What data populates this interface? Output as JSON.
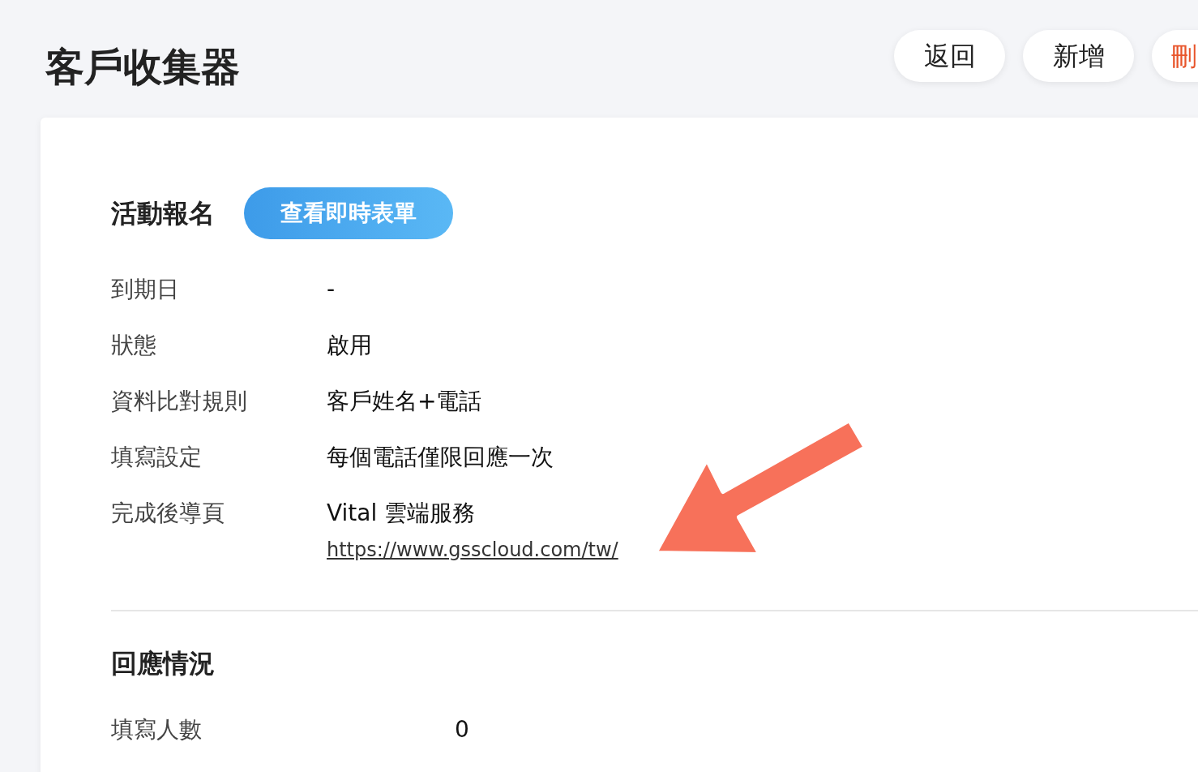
{
  "page": {
    "title": "客戶收集器"
  },
  "header_buttons": [
    {
      "label": "返回",
      "kind": "normal"
    },
    {
      "label": "新增",
      "kind": "normal"
    },
    {
      "label": "刪",
      "kind": "danger"
    }
  ],
  "form_section": {
    "title": "活動報名",
    "action_button": "查看即時表單",
    "fields": [
      {
        "label": "到期日",
        "value": "-"
      },
      {
        "label": "狀態",
        "value": "啟用"
      },
      {
        "label": "資料比對規則",
        "value": "客戶姓名+電話"
      },
      {
        "label": "填寫設定",
        "value": "每個電話僅限回應一次"
      },
      {
        "label": "完成後導頁",
        "value": "Vital 雲端服務",
        "link": "https://www.gsscloud.com/tw/"
      }
    ]
  },
  "response_section": {
    "title": "回應情況",
    "fields": [
      {
        "label": "填寫人數",
        "value": "0"
      }
    ]
  }
}
